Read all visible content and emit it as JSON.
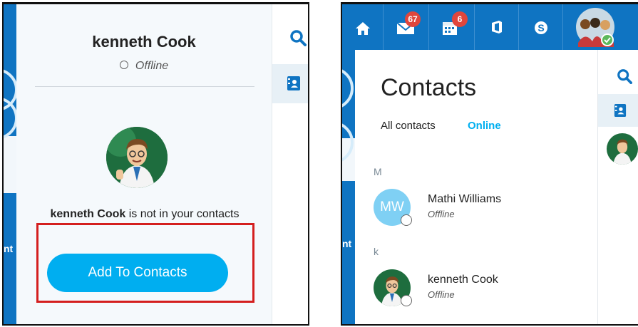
{
  "colors": {
    "accent": "#00aef0",
    "brand_blue": "#0f74c2",
    "highlight_red": "#d41f1f",
    "badge_red": "#e0463c"
  },
  "left_panel": {
    "profile_name": "kenneth Cook",
    "presence_status": "Offline",
    "not_in_contacts_name": "kenneth Cook",
    "not_in_contacts_text": " is not in your contacts",
    "add_button_label": "Add To Contacts",
    "side_fragment": "nt"
  },
  "right_panel": {
    "topbar": {
      "icons": [
        "home-icon",
        "mail-icon",
        "calendar-icon",
        "office-icon",
        "skype-icon",
        "profile-avatar"
      ],
      "mail_badge": "67",
      "calendar_badge": "6"
    },
    "title": "Contacts",
    "filters": {
      "all": "All contacts",
      "online": "Online"
    },
    "groups": [
      {
        "letter": "M",
        "contacts": [
          {
            "initials": "MW",
            "name": "Mathi Williams",
            "status": "Offline"
          }
        ]
      },
      {
        "letter": "k",
        "contacts": [
          {
            "initials": "",
            "name": "kenneth Cook",
            "status": "Offline"
          }
        ]
      }
    ],
    "side_fragment": "nt"
  }
}
